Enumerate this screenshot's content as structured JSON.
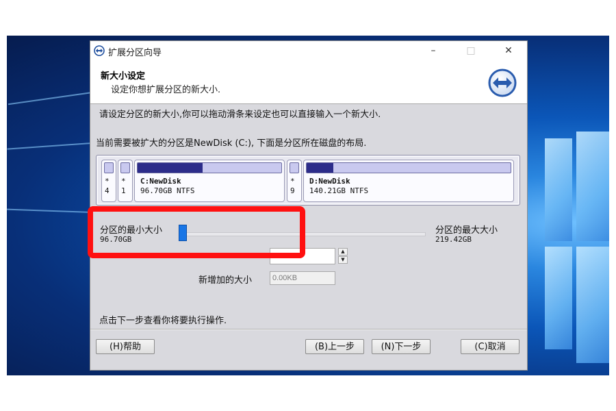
{
  "window": {
    "title": "扩展分区向导",
    "controls": {
      "minimize": "–",
      "maximize": "□",
      "close": "✕"
    }
  },
  "header": {
    "title": "新大小设定",
    "subtitle": "设定你想扩展分区的新大小."
  },
  "body": {
    "instruction": "请设定分区的新大小,你可以拖动滑条来设定也可以直接输入一个新大小.",
    "layout_intro": "当前需要被扩大的分区是NewDisk (C:), 下面是分区所在磁盘的布局."
  },
  "disk_layout": {
    "partitions": [
      {
        "line1": "*",
        "line2": "4",
        "used_fraction": 0.0
      },
      {
        "line1": "*",
        "line2": "1",
        "used_fraction": 0.0
      },
      {
        "line1": "C:NewDisk",
        "line2": "96.70GB NTFS",
        "used_fraction": 0.45
      },
      {
        "line1": "*",
        "line2": "9",
        "used_fraction": 0.0
      },
      {
        "line1": "D:NewDisk",
        "line2": "140.21GB NTFS",
        "used_fraction": 0.13
      }
    ]
  },
  "slider": {
    "min_label": "分区的最小大小",
    "min_value": "96.70GB",
    "max_label": "分区的最大大小",
    "max_value": "219.42GB",
    "position_fraction": 0.0
  },
  "fields": {
    "new_size_value": "",
    "added_size_label": "新增加的大小",
    "added_size_value": "0.00KB"
  },
  "footer": {
    "hint": "点击下一步查看你将要执行操作.",
    "help": "(H)帮助",
    "back": "(B)上一步",
    "next": "(N)下一步",
    "cancel": "(C)取消"
  },
  "colors": {
    "highlight": "#ff1010",
    "slider_thumb": "#1976e6",
    "partition_used": "#2c2c8a",
    "partition_free": "#c9c9ef"
  }
}
